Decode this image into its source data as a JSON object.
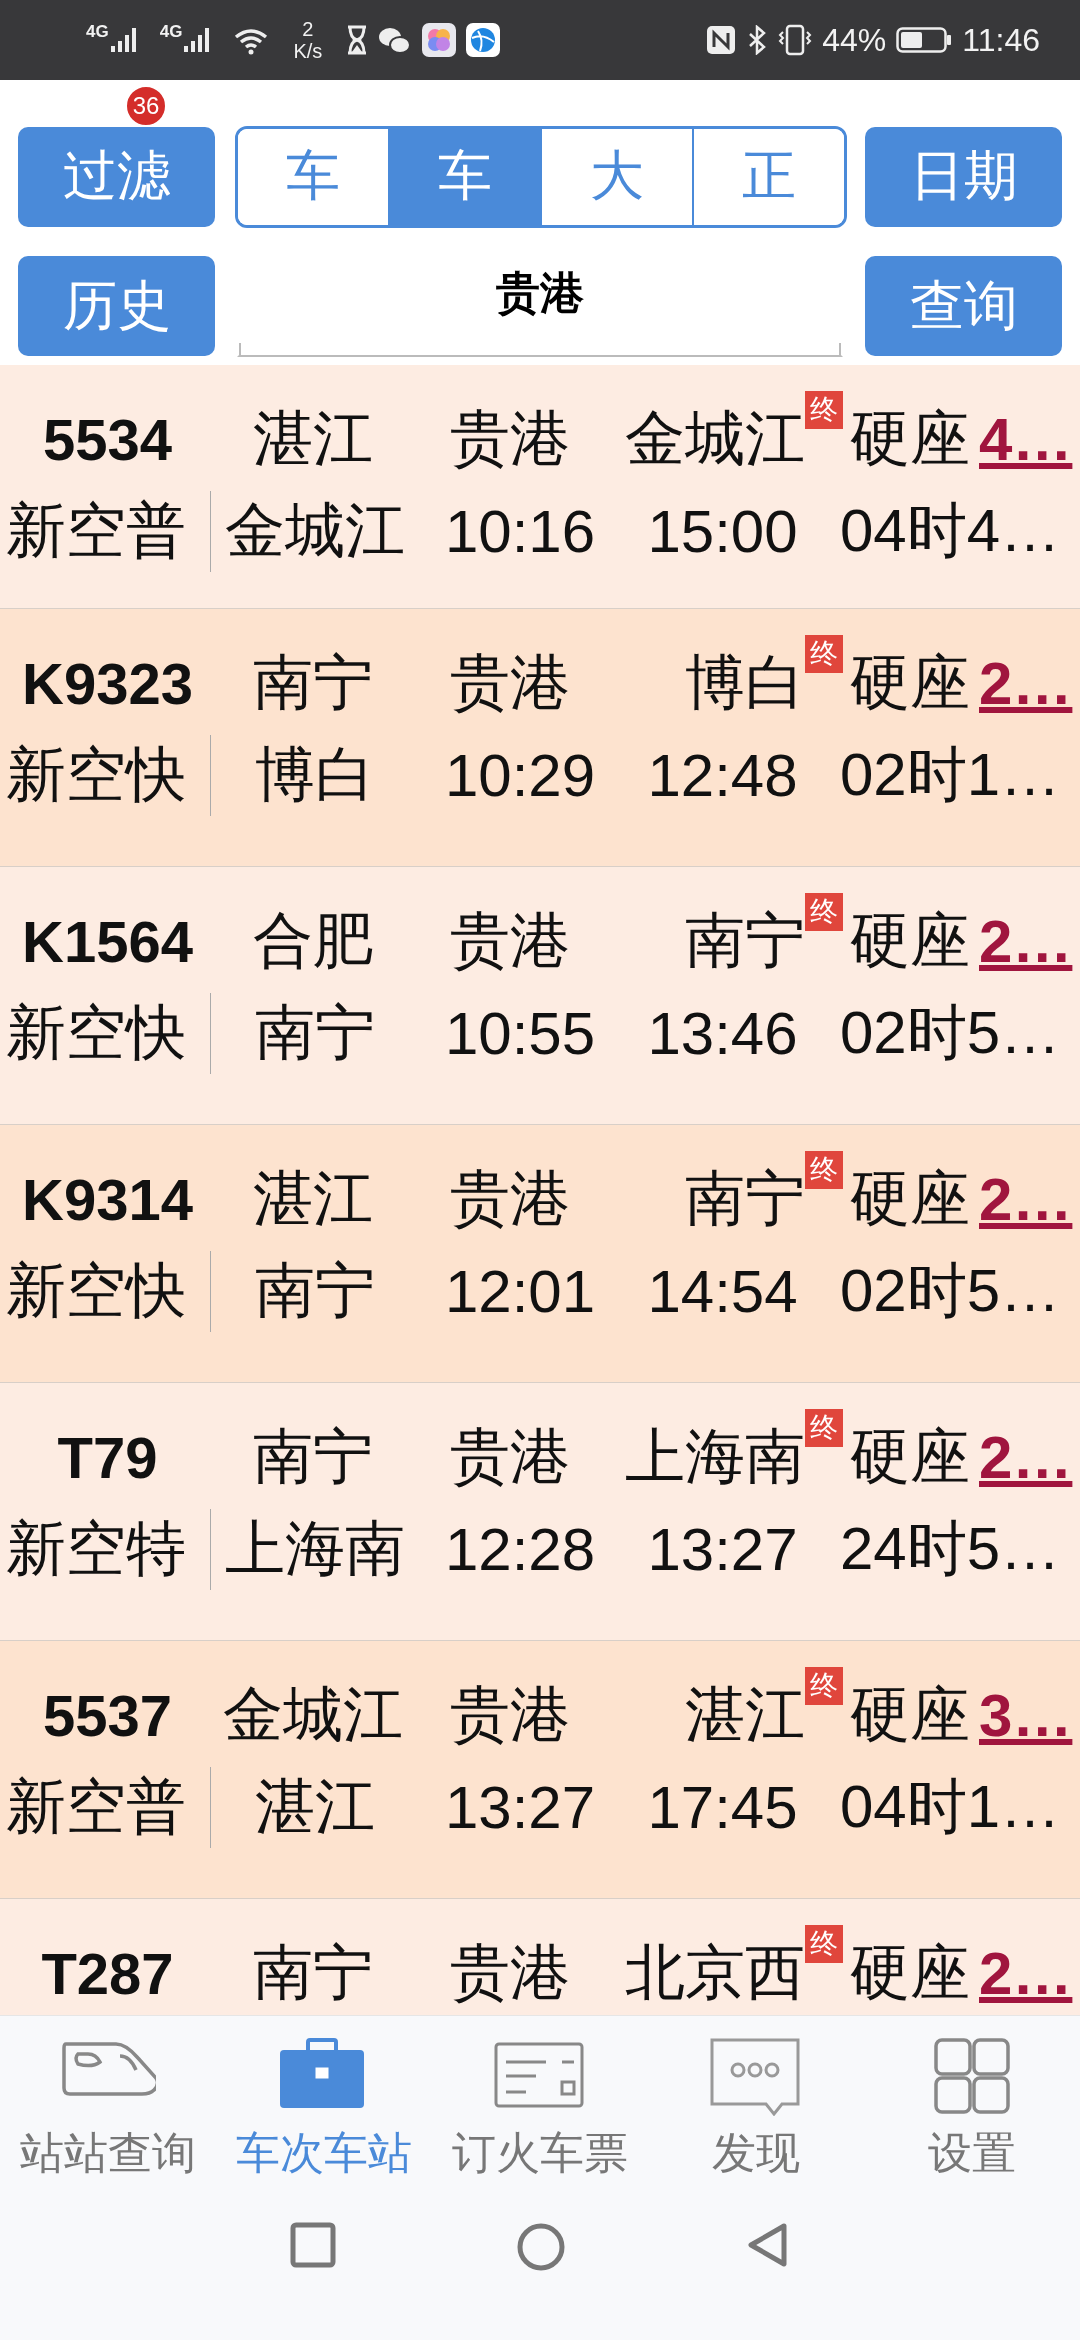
{
  "status_bar": {
    "signal_1": "4G",
    "signal_2": "4G",
    "speed_value": "2",
    "speed_unit": "K/s",
    "battery": "44%",
    "time": "11:46"
  },
  "toolbar": {
    "filter_button": {
      "label": "过滤",
      "badge": "36"
    },
    "segments": [
      {
        "label": "车",
        "selected": false
      },
      {
        "label": "车",
        "selected": true
      },
      {
        "label": "大",
        "selected": false
      },
      {
        "label": "正",
        "selected": false
      }
    ],
    "date_button": "日期",
    "history_button": "历史",
    "station_field": {
      "value": "贵港"
    },
    "query_button": "查询"
  },
  "trains": [
    {
      "number": "5534",
      "origin": "湛江",
      "station": "贵港",
      "terminus": "金城江",
      "end_mark": "终",
      "seat": "硬座",
      "count": "4…",
      "train_type": "新空普",
      "arrival_station": "金城江",
      "depart_time": "10:16",
      "arrive_time": "15:00",
      "duration": "04时4…"
    },
    {
      "number": "K9323",
      "origin": "南宁",
      "station": "贵港",
      "terminus": "博白",
      "end_mark": "终",
      "seat": "硬座",
      "count": "2…",
      "train_type": "新空快",
      "arrival_station": "博白",
      "depart_time": "10:29",
      "arrive_time": "12:48",
      "duration": "02时1…"
    },
    {
      "number": "K1564",
      "origin": "合肥",
      "station": "贵港",
      "terminus": "南宁",
      "end_mark": "终",
      "seat": "硬座",
      "count": "2…",
      "train_type": "新空快",
      "arrival_station": "南宁",
      "depart_time": "10:55",
      "arrive_time": "13:46",
      "duration": "02时5…"
    },
    {
      "number": "K9314",
      "origin": "湛江",
      "station": "贵港",
      "terminus": "南宁",
      "end_mark": "终",
      "seat": "硬座",
      "count": "2…",
      "train_type": "新空快",
      "arrival_station": "南宁",
      "depart_time": "12:01",
      "arrive_time": "14:54",
      "duration": "02时5…"
    },
    {
      "number": "T79",
      "origin": "南宁",
      "station": "贵港",
      "terminus": "上海南",
      "end_mark": "终",
      "seat": "硬座",
      "count": "2…",
      "train_type": "新空特",
      "arrival_station": "上海南",
      "depart_time": "12:28",
      "arrive_time": "13:27",
      "duration": "24时5…"
    },
    {
      "number": "5537",
      "origin": "金城江",
      "station": "贵港",
      "terminus": "湛江",
      "end_mark": "终",
      "seat": "硬座",
      "count": "3…",
      "train_type": "新空普",
      "arrival_station": "湛江",
      "depart_time": "13:27",
      "arrive_time": "17:45",
      "duration": "04时1…"
    },
    {
      "number": "T287",
      "origin": "南宁",
      "station": "贵港",
      "terminus": "北京西",
      "end_mark": "终",
      "seat": "硬座",
      "count": "2…"
    }
  ],
  "bottom_nav": [
    {
      "label": "站站查询",
      "kind": "train",
      "selected": false
    },
    {
      "label": "车次车站",
      "kind": "briefcase",
      "selected": true
    },
    {
      "label": "订火车票",
      "kind": "ticket",
      "selected": false
    },
    {
      "label": "发现",
      "kind": "chat",
      "selected": false
    },
    {
      "label": "设置",
      "kind": "grid",
      "selected": false
    }
  ]
}
